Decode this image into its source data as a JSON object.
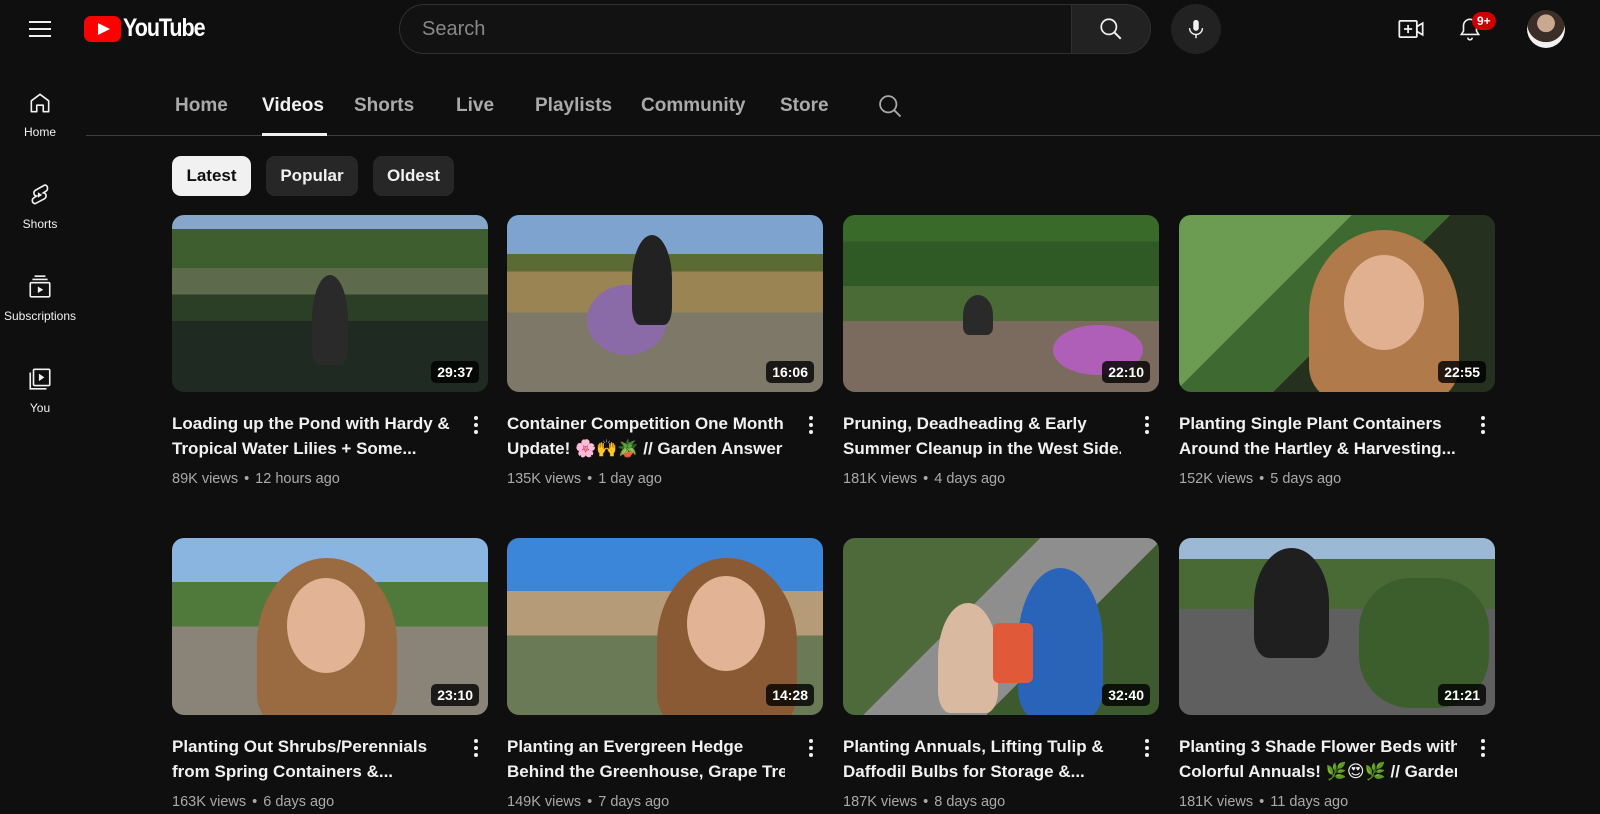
{
  "masthead": {
    "logo_text": "YouTube",
    "search_placeholder": "Search",
    "notification_count": "9+"
  },
  "guide": [
    {
      "label": "Home",
      "icon": "home-icon"
    },
    {
      "label": "Shorts",
      "icon": "shorts-icon"
    },
    {
      "label": "Subscriptions",
      "icon": "subscriptions-icon"
    },
    {
      "label": "You",
      "icon": "you-icon"
    }
  ],
  "tabs": [
    {
      "label": "Home"
    },
    {
      "label": "Videos",
      "active": true
    },
    {
      "label": "Shorts"
    },
    {
      "label": "Live"
    },
    {
      "label": "Playlists"
    },
    {
      "label": "Community"
    },
    {
      "label": "Store"
    }
  ],
  "chips": [
    {
      "label": "Latest",
      "active": true
    },
    {
      "label": "Popular"
    },
    {
      "label": "Oldest"
    }
  ],
  "videos": [
    {
      "title_line1": "Loading up the Pond with Hardy &",
      "title_line2": "Tropical Water Lilies + Some...",
      "views": "89K views",
      "age": "12 hours ago",
      "duration": "29:37"
    },
    {
      "title_line1": "Container Competition One Month",
      "title_line2": "Update! 🌸🙌🪴 // Garden Answer",
      "views": "135K views",
      "age": "1 day ago",
      "duration": "16:06"
    },
    {
      "title_line1": "Pruning, Deadheading & Early",
      "title_line2": "Summer Cleanup in the West Side...",
      "views": "181K views",
      "age": "4 days ago",
      "duration": "22:10"
    },
    {
      "title_line1": "Planting Single Plant Containers",
      "title_line2": "Around the Hartley & Harvesting...",
      "views": "152K views",
      "age": "5 days ago",
      "duration": "22:55"
    },
    {
      "title_line1": "Planting Out Shrubs/Perennials",
      "title_line2": "from Spring Containers &...",
      "views": "163K views",
      "age": "6 days ago",
      "duration": "23:10"
    },
    {
      "title_line1": "Planting an Evergreen Hedge",
      "title_line2": "Behind the Greenhouse, Grape Tre...",
      "views": "149K views",
      "age": "7 days ago",
      "duration": "14:28"
    },
    {
      "title_line1": "Planting Annuals, Lifting Tulip &",
      "title_line2": "Daffodil Bulbs for Storage &...",
      "views": "187K views",
      "age": "8 days ago",
      "duration": "32:40"
    },
    {
      "title_line1": "Planting 3 Shade Flower Beds with",
      "title_line2": "Colorful Annuals! 🌿😍🌿 // Garden...",
      "views": "181K views",
      "age": "11 days ago",
      "duration": "21:21"
    }
  ],
  "separator": "•"
}
